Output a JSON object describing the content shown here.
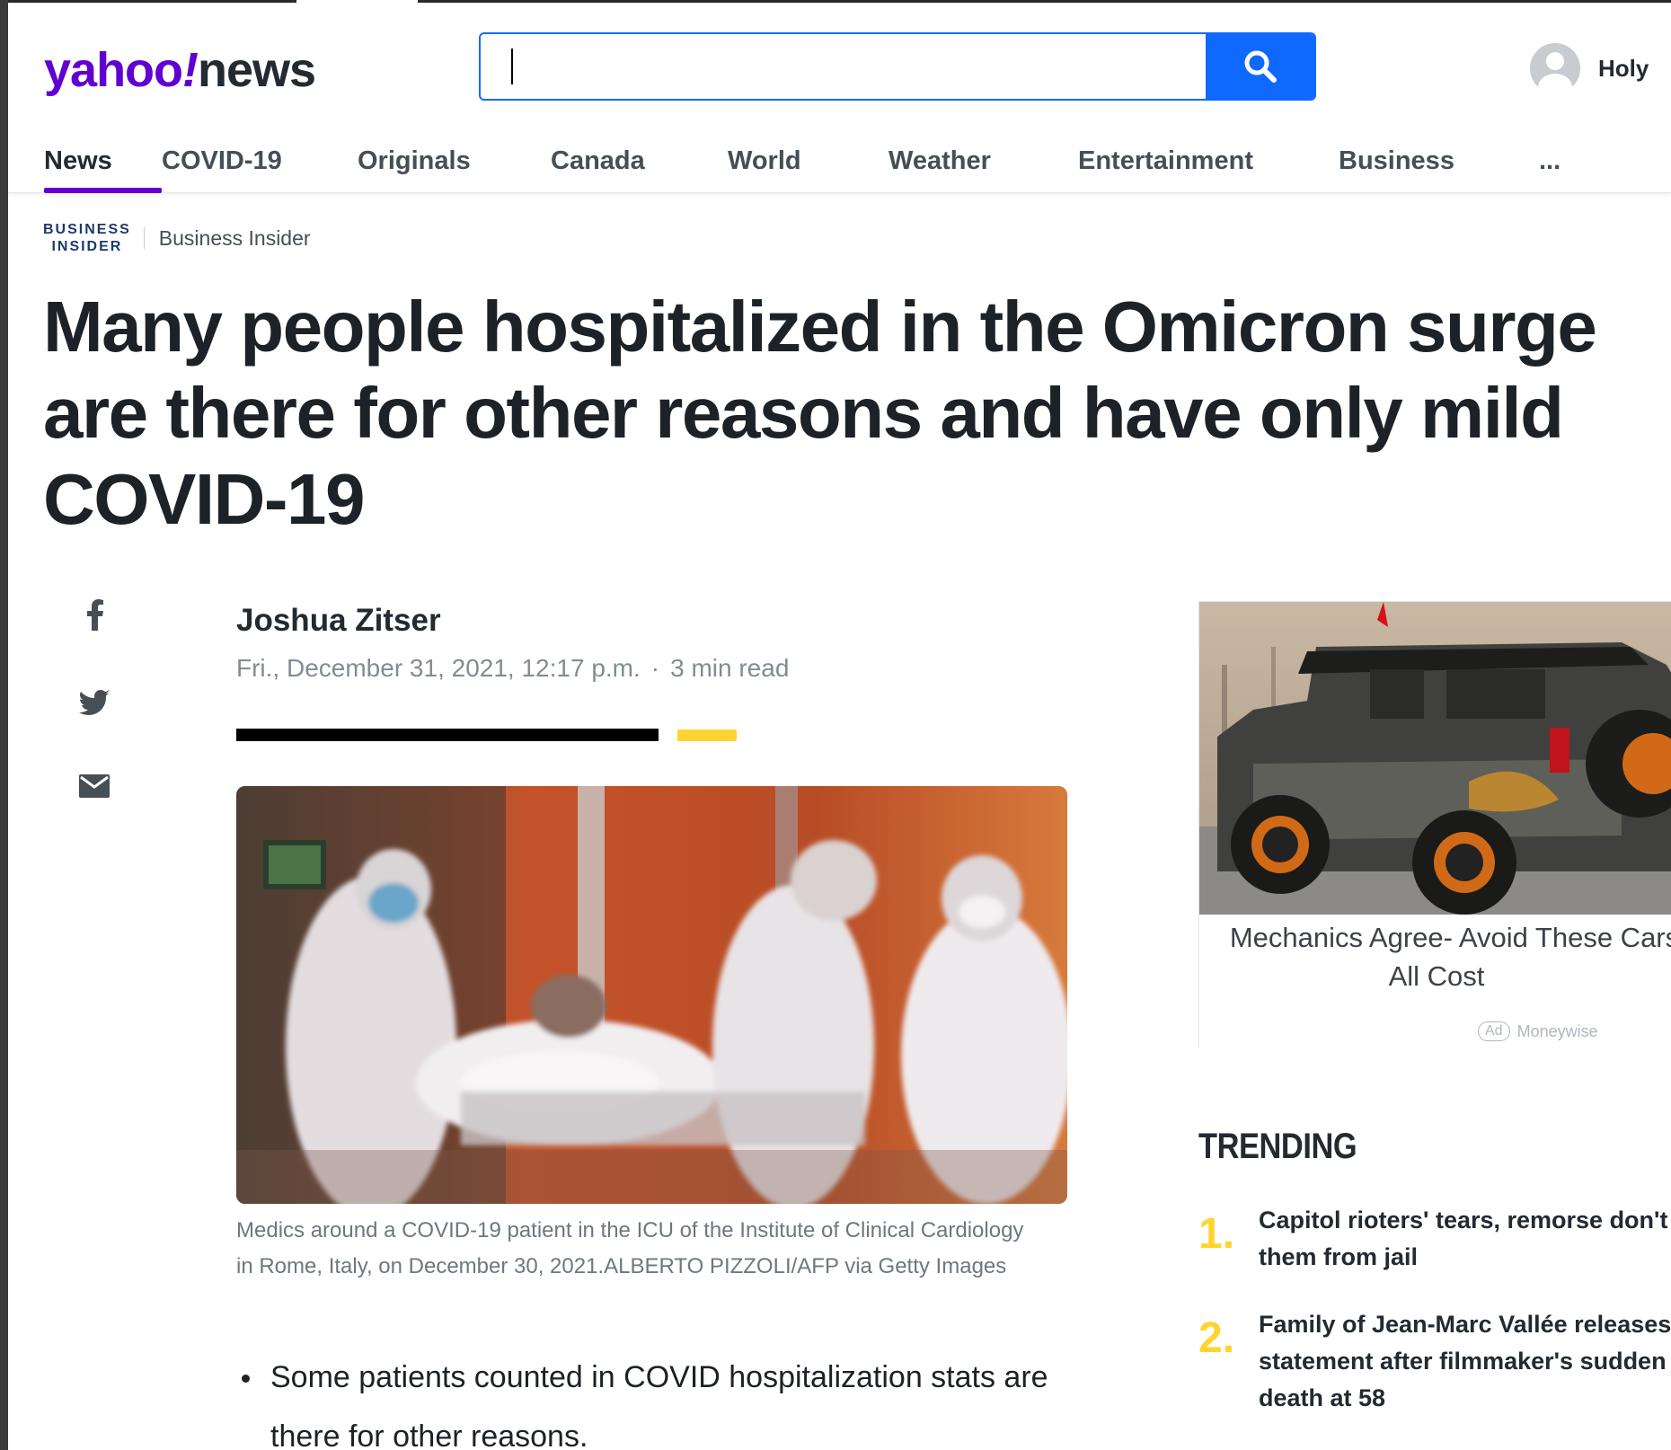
{
  "header": {
    "logo_main": "yahoo",
    "logo_slash": "!",
    "logo_sub": "news",
    "search": {
      "value": "",
      "placeholder": ""
    },
    "user_name": "Holy"
  },
  "nav": {
    "items": [
      {
        "label": "News",
        "active": true
      },
      {
        "label": "COVID-19"
      },
      {
        "label": "Originals"
      },
      {
        "label": "Canada"
      },
      {
        "label": "World"
      },
      {
        "label": "Weather"
      },
      {
        "label": "Entertainment"
      },
      {
        "label": "Business"
      },
      {
        "label": "..."
      }
    ]
  },
  "provider": {
    "logo_line1": "BUSINESS",
    "logo_line2": "INSIDER",
    "name": "Business Insider"
  },
  "article": {
    "headline": "Many people hospitalized in the Omicron surge are there for other reasons and have only mild COVID-19",
    "author": "Joshua Zitser",
    "date": "Fri., December 31, 2021, 12:17 p.m.",
    "separator": "·",
    "read_time": "3 min read",
    "caption": "Medics around a COVID-19 patient in the ICU of the Institute of Clinical Cardiology in Rome, Italy, on December 30, 2021.ALBERTO PIZZOLI/AFP via Getty Images",
    "bullets": [
      "Some patients counted in COVID hospitalization stats are there for other reasons."
    ]
  },
  "share": {
    "icons": [
      "facebook-icon",
      "twitter-icon",
      "mail-icon"
    ]
  },
  "ad": {
    "title_line1": "Mechanics Agree- Avoid These Cars",
    "title_line2": "All Cost",
    "badge": "Ad",
    "sponsor": "Moneywise"
  },
  "trending": {
    "title": "TRENDING",
    "items": [
      {
        "num": "1.",
        "lines": [
          "Capitol rioters' tears, remorse don't",
          "them from jail"
        ]
      },
      {
        "num": "2.",
        "lines": [
          "Family of Jean-Marc Vallée releases",
          "statement after filmmaker's sudden",
          "death at 58"
        ]
      }
    ]
  },
  "colors": {
    "brand_purple": "#6001d2",
    "search_blue": "#0f69ff",
    "accent_yellow": "#ffd330"
  }
}
